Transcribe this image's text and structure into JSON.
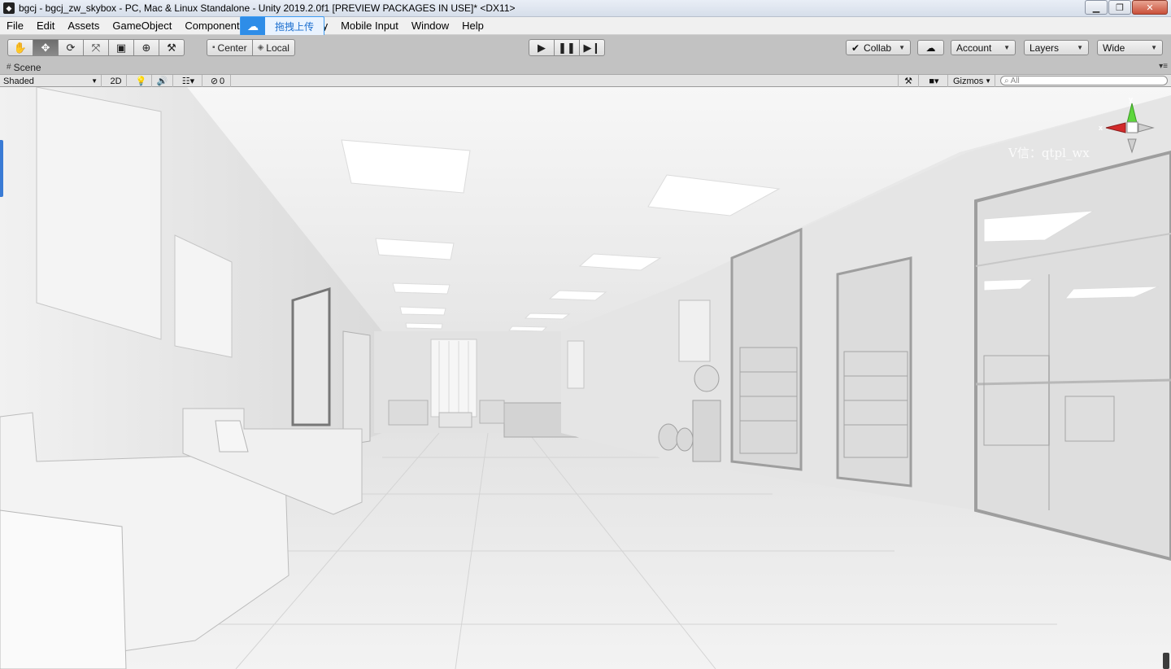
{
  "window": {
    "title": "bgcj - bgcj_zw_skybox - PC, Mac & Linux Standalone - Unity 2019.2.0f1 [PREVIEW PACKAGES IN USE]* <DX11>",
    "controls": [
      "minimize",
      "maximize",
      "close"
    ]
  },
  "menu": {
    "items": [
      "File",
      "Edit",
      "Assets",
      "GameObject",
      "Component",
      "y",
      "Mobile Input",
      "Window",
      "Help"
    ]
  },
  "upload_overlay": {
    "label": "拖拽上传"
  },
  "toolbar": {
    "transform_tools": [
      "hand-icon",
      "move-icon",
      "rotate-icon",
      "scale-icon",
      "rect-icon",
      "transform-icon",
      "custom-tool-icon"
    ],
    "active_tool": "move-icon",
    "pivot_label": "Center",
    "space_label": "Local",
    "play_controls": [
      "play-icon",
      "pause-icon",
      "step-icon"
    ],
    "collab_label": "Collab",
    "account_label": "Account",
    "layers_label": "Layers",
    "layout_label": "Wide"
  },
  "scene_tab": {
    "label": "Scene"
  },
  "scene_toolbar": {
    "draw_mode": "Shaded",
    "mode_2d": "2D",
    "hidden_count": "0",
    "gizmos_label": "Gizmos",
    "search_placeholder": "All"
  },
  "viewport": {
    "watermark": "V信：qtpl_wx",
    "gizmo_axes": {
      "y": "y",
      "x": "x"
    },
    "colors": {
      "y_axis": "#5dd63c",
      "x_axis": "#d22a2a",
      "selection_accent": "#3a7bd5"
    }
  }
}
